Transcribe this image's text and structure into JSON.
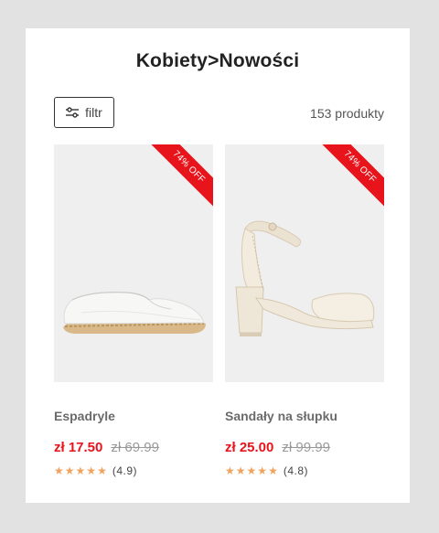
{
  "header": {
    "title": "Kobiety>Nowości"
  },
  "toolbar": {
    "filter_label": "filtr",
    "product_count": "153 produkty"
  },
  "colors": {
    "accent": "#e8141c",
    "star": "#f0a35e",
    "background": "#e2e2e2"
  },
  "products": [
    {
      "name": "Espadryle",
      "price": "zł 17.50",
      "old_price": "zł 69.99",
      "discount": "74% OFF",
      "rating": 4.9,
      "rating_text": "(4.9)",
      "stars": 5,
      "image": "white-espadrille"
    },
    {
      "name": "Sandały na słupku",
      "price": "zł 25.00",
      "old_price": "zł 99.99",
      "discount": "74% OFF",
      "rating": 4.8,
      "rating_text": "(4.8)",
      "stars": 5,
      "image": "beige-block-heel-sandal"
    }
  ]
}
